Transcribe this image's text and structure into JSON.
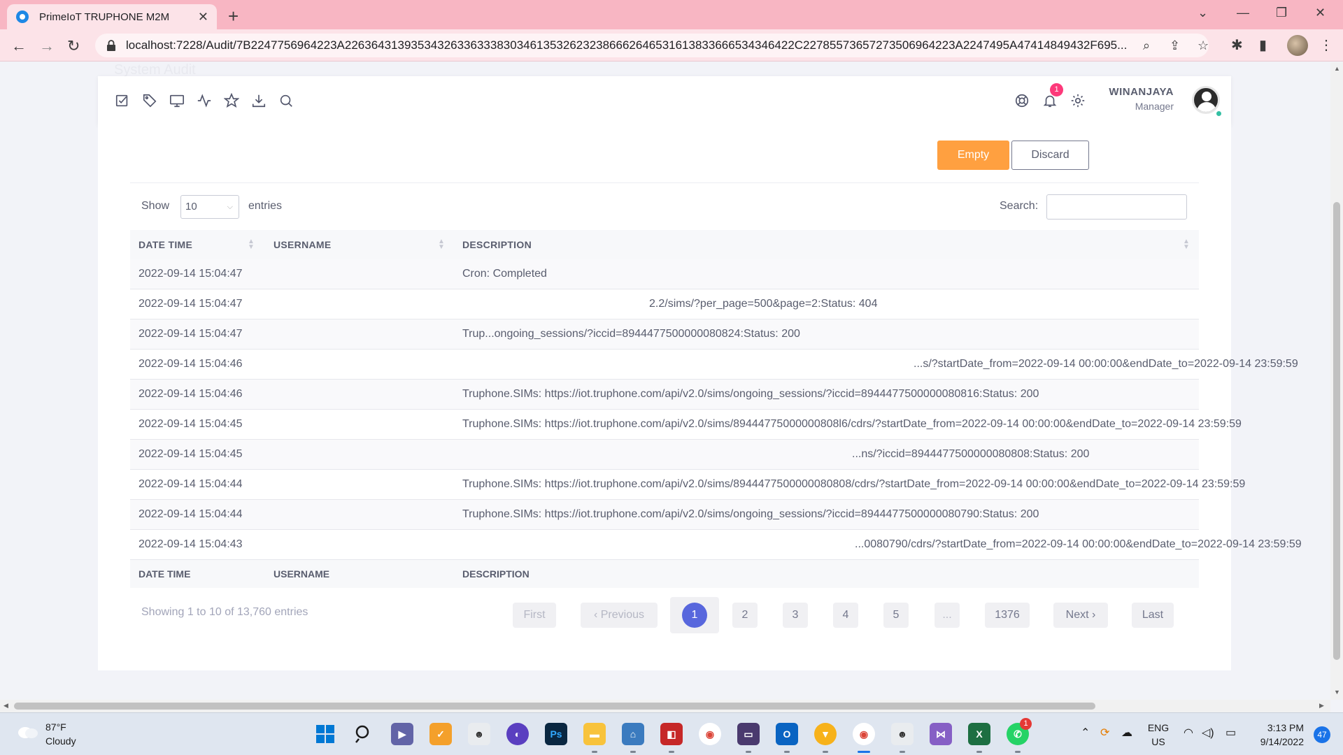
{
  "browser": {
    "tab_title": "PrimeIoT TRUPHONE M2M",
    "url_host": "localhost",
    "url": "localhost:7228/Audit/7B2247756964223A22636431393534326336333830346135326232386662646531613833666534346422C22785573657273506964223A2247495A47414849432F695...",
    "new_tab": "+",
    "close": "✕"
  },
  "page": {
    "faded_title": "System Audit"
  },
  "header": {
    "user_name": "WINANJAYA",
    "user_role": "Manager",
    "notification_count": "1"
  },
  "actions": {
    "empty_label": "Empty",
    "discard_label": "Discard"
  },
  "table_controls": {
    "show_label": "Show",
    "page_length": "10",
    "entries_label": "entries",
    "search_label": "Search:"
  },
  "table": {
    "columns": [
      "DATE TIME",
      "USERNAME",
      "DESCRIPTION"
    ],
    "rows": [
      {
        "datetime": "2022-09-14 15:04:47",
        "username": "",
        "description": "Cron: Completed"
      },
      {
        "datetime": "2022-09-14 15:04:47",
        "username": "",
        "description": "2.2/sims/?per_page=500&page=2:Status: 404"
      },
      {
        "datetime": "2022-09-14 15:04:47",
        "username": "",
        "description": "Trup...ongoing_sessions/?iccid=8944477500000080824:Status: 200"
      },
      {
        "datetime": "2022-09-14 15:04:46",
        "username": "",
        "description": "...s/?startDate_from=2022-09-14 00:00:00&endDate_to=2022-09-14 23:59:59"
      },
      {
        "datetime": "2022-09-14 15:04:46",
        "username": "",
        "description": "Truphone.SIMs: https://iot.truphone.com/api/v2.0/sims/ongoing_sessions/?iccid=8944477500000080816:Status: 200"
      },
      {
        "datetime": "2022-09-14 15:04:45",
        "username": "",
        "description": "Truphone.SIMs: https://iot.truphone.com/api/v2.0/sims/89444775000000808l6/cdrs/?startDate_from=2022-09-14 00:00:00&endDate_to=2022-09-14 23:59:59"
      },
      {
        "datetime": "2022-09-14 15:04:45",
        "username": "",
        "description": "...ns/?iccid=8944477500000080808:Status: 200"
      },
      {
        "datetime": "2022-09-14 15:04:44",
        "username": "",
        "description": "Truphone.SIMs: https://iot.truphone.com/api/v2.0/sims/8944477500000080808/cdrs/?startDate_from=2022-09-14 00:00:00&endDate_to=2022-09-14 23:59:59"
      },
      {
        "datetime": "2022-09-14 15:04:44",
        "username": "",
        "description": "Truphone.SIMs: https://iot.truphone.com/api/v2.0/sims/ongoing_sessions/?iccid=8944477500000080790:Status: 200"
      },
      {
        "datetime": "2022-09-14 15:04:43",
        "username": "",
        "description": "...0080790/cdrs/?startDate_from=2022-09-14 00:00:00&endDate_to=2022-09-14 23:59:59"
      }
    ]
  },
  "pagination": {
    "info": "Showing 1 to 10 of 13,760 entries",
    "first": "First",
    "previous": "‹ Previous",
    "pages": [
      "1",
      "2",
      "3",
      "4",
      "5",
      "...",
      "1376"
    ],
    "current_page": "1",
    "next": "Next ›",
    "last": "Last"
  },
  "taskbar": {
    "weather_temp": "87°F",
    "weather_desc": "Cloudy",
    "lang": "ENG",
    "region": "US",
    "time": "3:13 PM",
    "date": "9/14/2022",
    "notification_count": "47",
    "whatsapp_badge": "1"
  },
  "colors": {
    "accent": "#5867dd",
    "empty_button": "#ffa040",
    "chrome_titlebar": "#f8b6c3"
  }
}
